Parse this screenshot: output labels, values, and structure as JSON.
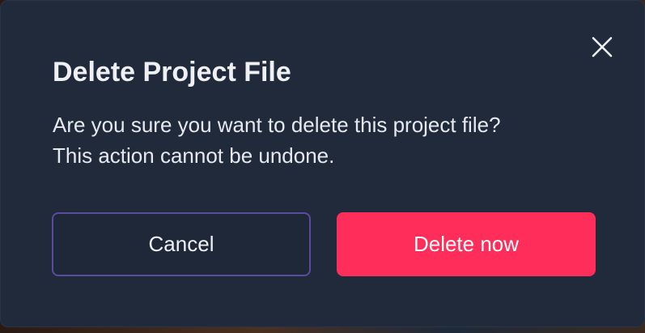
{
  "dialog": {
    "title": "Delete Project File",
    "message_line1": "Are you sure you want to delete this project file?",
    "message_line2": "This action cannot be undone.",
    "close_icon": "close-icon",
    "cancel_label": "Cancel",
    "delete_label": "Delete now"
  },
  "colors": {
    "dialog_background": "#212a3a",
    "cancel_border": "#5b4a9e",
    "delete_background": "#ff2d5a",
    "text": "#eef0f4"
  }
}
